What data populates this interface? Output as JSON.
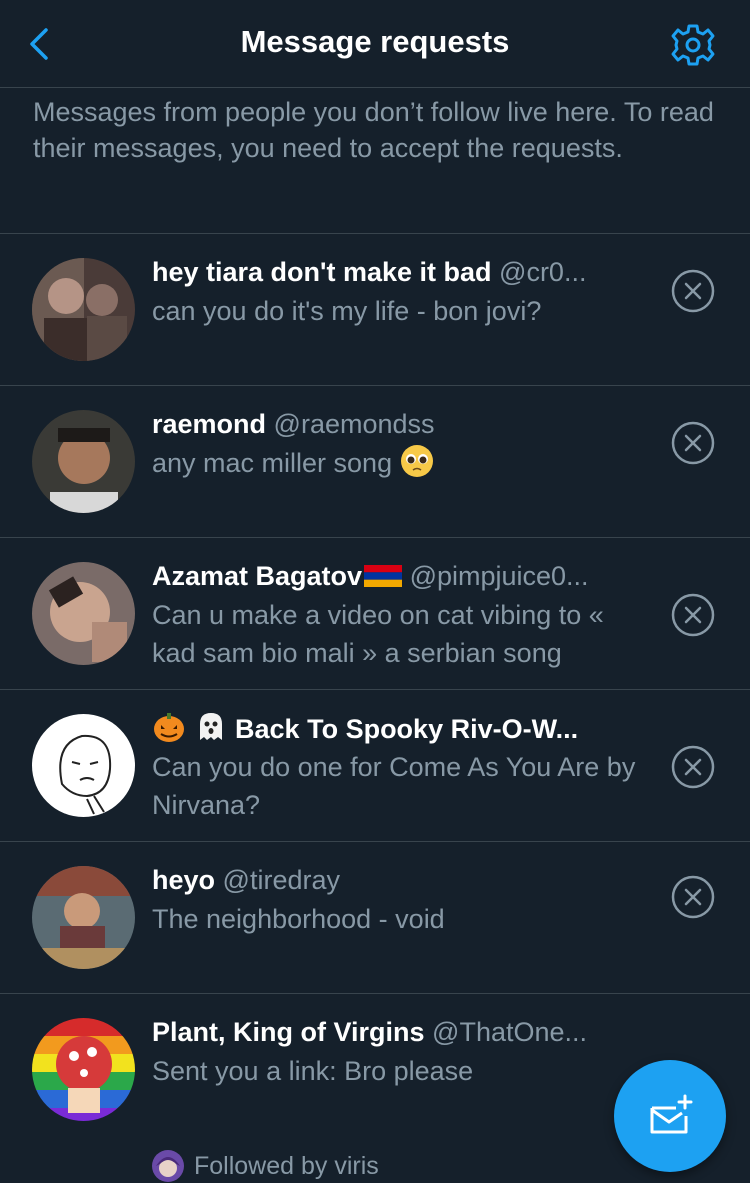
{
  "header": {
    "title": "Message requests",
    "back_icon": "chevron-left-icon",
    "settings_icon": "gear-icon",
    "accent": "#1da1f2"
  },
  "notice": "Messages from people you don’t follow live here. To read their messages, you need to accept the requests.",
  "requests": [
    {
      "name": "hey tiara don't make it bad",
      "handle": "@cr0...",
      "message": "can you do it's my life - bon jovi?"
    },
    {
      "name": "raemond",
      "handle": "@raemondss",
      "message": "any mac miller song",
      "message_emoji": "pleading-face-emoji"
    },
    {
      "name": "Azamat Bagatov",
      "name_emoji": "armenia-flag",
      "handle": "@pimpjuice0...",
      "message": "Can u make a video on cat vibing to « kad sam bio mali » a serbian song"
    },
    {
      "name": "Back To Spooky Riv-O-W...",
      "name_emoji": "jack-o-lantern-and-ghost-emoji",
      "handle": "",
      "message": "Can you do one for Come As You Are by Nirvana?"
    },
    {
      "name": "heyo",
      "handle": "@tiredray",
      "message": "The neighborhood - void"
    },
    {
      "name": "Plant, King of Virgins",
      "handle": "@ThatOne...",
      "message": "Sent you a link: Bro please",
      "followed_by": "Followed by viris"
    }
  ],
  "compose_icon": "new-message-icon"
}
